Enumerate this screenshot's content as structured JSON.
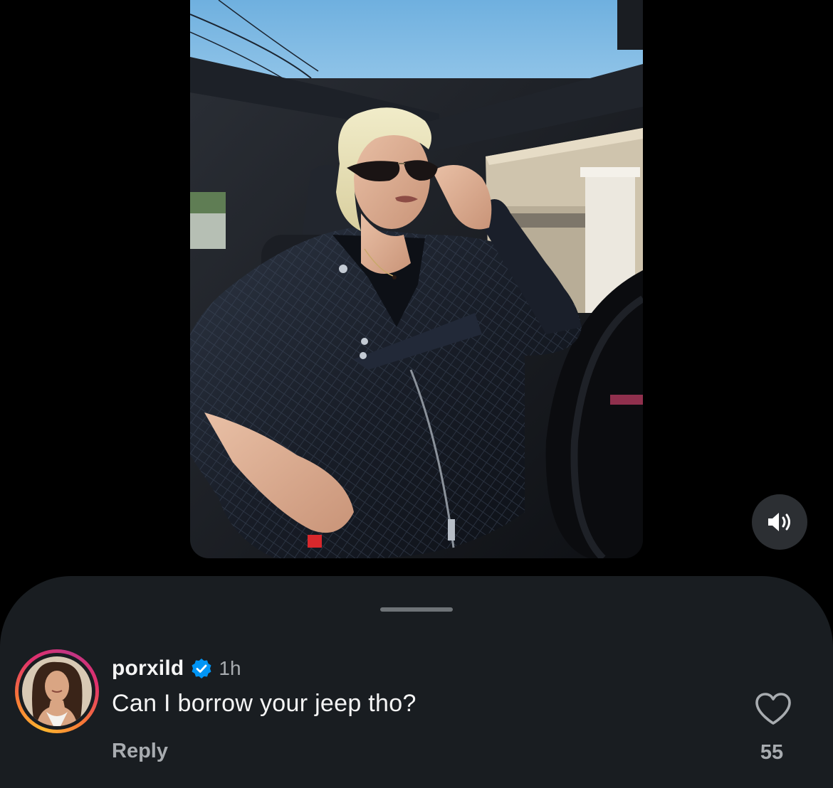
{
  "video": {
    "description_icon": "video-frame"
  },
  "controls": {
    "mute_icon": "speaker-icon"
  },
  "comment": {
    "username": "porxild",
    "verified": true,
    "time": "1h",
    "text": "Can I borrow your jeep tho?",
    "reply_label": "Reply",
    "like_count": "55",
    "like_icon": "heart-outline-icon"
  },
  "colors": {
    "sheet_bg": "#191d21",
    "verified_blue": "#0095f6",
    "muted_text": "#a8acb0",
    "primary_text": "#f5f5f5"
  }
}
